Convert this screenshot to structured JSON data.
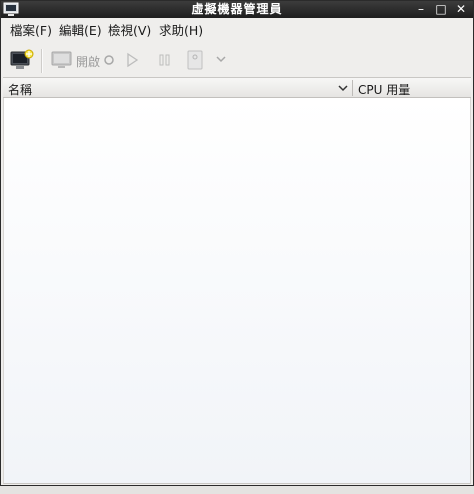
{
  "window": {
    "title": "虛擬機器管理員"
  },
  "menubar": {
    "items": [
      {
        "label": "檔案(F)"
      },
      {
        "label": "編輯(E)"
      },
      {
        "label": "檢視(V)"
      },
      {
        "label": "求助(H)"
      }
    ]
  },
  "toolbar": {
    "open_label": "開啟"
  },
  "table": {
    "columns": [
      {
        "label": "名稱"
      },
      {
        "label": "CPU 用量"
      }
    ],
    "rows": []
  },
  "icons": {
    "app": "monitor-icon",
    "new_vm": "new-vm-icon",
    "open_console": "monitor-icon",
    "power_on": "play-icon",
    "pause": "pause-icon",
    "shutdown": "shutdown-icon",
    "dropdown": "chevron-down-icon"
  },
  "colors": {
    "titlebar": "#2a2a2a",
    "menubar": "#efeeec",
    "list_background": "#ffffff"
  }
}
